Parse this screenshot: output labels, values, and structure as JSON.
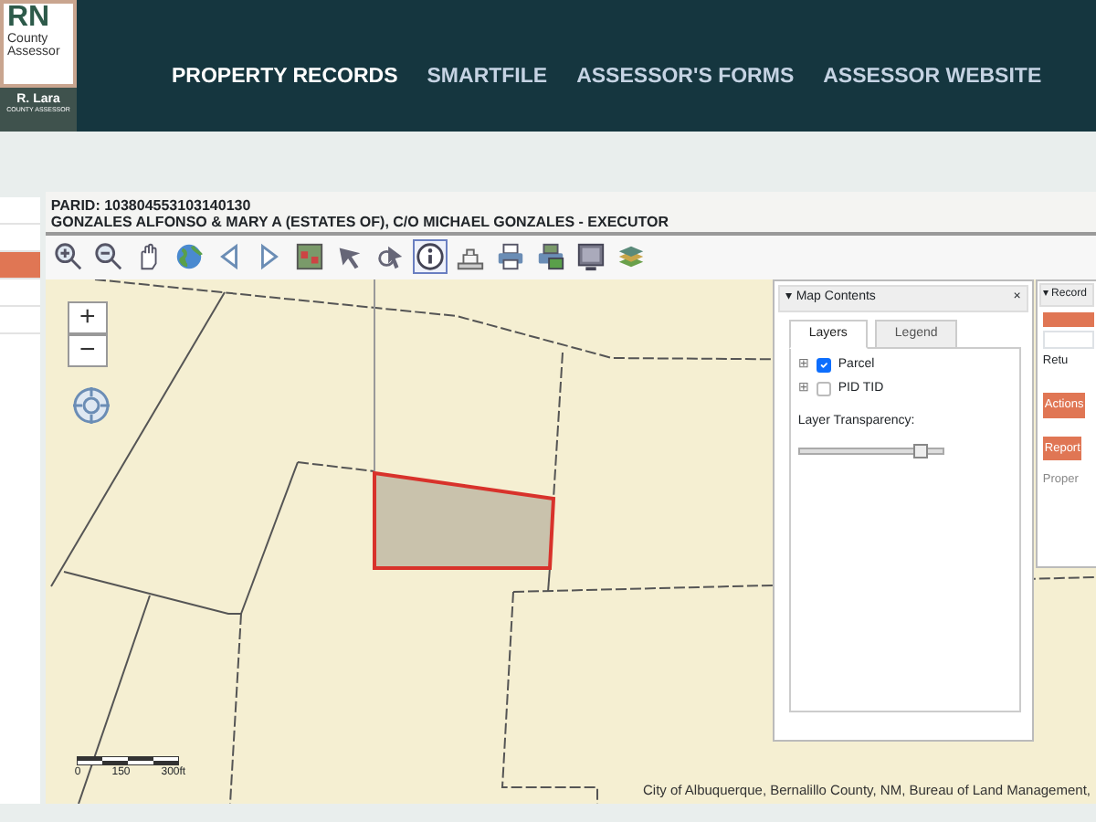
{
  "logo": {
    "mark": "RN",
    "line_1": "County",
    "line_2": "Assessor",
    "name": "R. Lara",
    "subtitle": "COUNTY ASSESSOR"
  },
  "nav": [
    {
      "label": "PROPERTY RECORDS",
      "selected": true
    },
    {
      "label": "SMARTFILE",
      "selected": false
    },
    {
      "label": "ASSESSOR'S FORMS",
      "selected": false
    },
    {
      "label": "ASSESSOR WEBSITE",
      "selected": false
    }
  ],
  "sidebar": {
    "items": [
      {
        "selected": false
      },
      {
        "selected": false
      },
      {
        "selected": true
      },
      {
        "selected": false
      },
      {
        "selected": false
      }
    ]
  },
  "parcel": {
    "parid": "PARID: 103804553103140130",
    "owner": "GONZALES ALFONSO & MARY A (ESTATES OF), C/O MICHAEL GONZALES - EXECUTOR"
  },
  "toolbar": [
    {
      "kind": "zoom-in",
      "selected": false
    },
    {
      "kind": "zoom-out",
      "selected": false
    },
    {
      "kind": "pan",
      "selected": false
    },
    {
      "kind": "globe",
      "selected": false
    },
    {
      "kind": "back",
      "selected": false
    },
    {
      "kind": "forward",
      "selected": false
    },
    {
      "kind": "map",
      "selected": false
    },
    {
      "kind": "select",
      "selected": false
    },
    {
      "kind": "select-point",
      "selected": false
    },
    {
      "kind": "info",
      "selected": true
    },
    {
      "kind": "measure",
      "selected": false
    },
    {
      "kind": "print",
      "selected": false
    },
    {
      "kind": "print-map",
      "selected": false
    },
    {
      "kind": "screen",
      "selected": false
    },
    {
      "kind": "layers",
      "selected": false
    }
  ],
  "map": {
    "zoom_in": "+",
    "zoom_out": "−",
    "scale": [
      "0",
      "150",
      "300ft"
    ],
    "attribution": "City of Albuquerque, Bernalillo County, NM, Bureau of Land Management,"
  },
  "map_contents": {
    "title": "Map Contents",
    "collapse": "▾",
    "close": "×",
    "tabs": [
      {
        "label": "Layers",
        "selected": true
      },
      {
        "label": "Legend",
        "selected": false
      }
    ],
    "layers": [
      {
        "name": "Parcel",
        "checked": true,
        "expand": "⊞"
      },
      {
        "name": "PID TID",
        "checked": false,
        "expand": "⊞"
      }
    ],
    "transparency_label": "Layer Transparency:",
    "transparency": {
      "level": 0.85
    }
  },
  "record_panel": {
    "collapse": "▾",
    "title": "Record",
    "return_text": "Retu",
    "actions": "Actions",
    "report": "Report",
    "property_text": "Proper"
  }
}
